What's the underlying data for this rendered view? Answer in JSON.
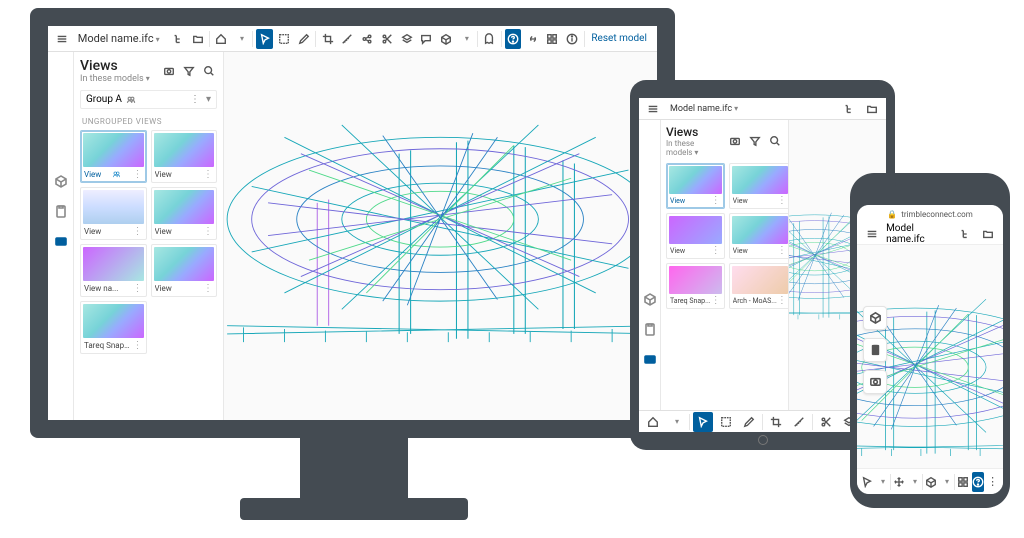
{
  "file": {
    "name": "Model name.ifc"
  },
  "url": "trimbleconnect.com",
  "views_panel": {
    "title": "Views",
    "filter": "In these models",
    "group": {
      "name": "Group A"
    },
    "section": "UNGROUPED VIEWS",
    "thumbs": [
      {
        "label": "View",
        "selected": true
      },
      {
        "label": "View"
      },
      {
        "label": "View"
      },
      {
        "label": "View"
      },
      {
        "label": "View na..."
      },
      {
        "label": "View"
      },
      {
        "label": "Tareq Snap..."
      }
    ],
    "tablet_thumbs": [
      {
        "label": "View",
        "selected": true
      },
      {
        "label": "View"
      },
      {
        "label": "View"
      },
      {
        "label": "View"
      },
      {
        "label": "Tareq Snap..."
      },
      {
        "label": "Arch - MoAS..."
      }
    ]
  },
  "reset_label": "Reset model",
  "colors": {
    "accent": "#005f9e"
  }
}
